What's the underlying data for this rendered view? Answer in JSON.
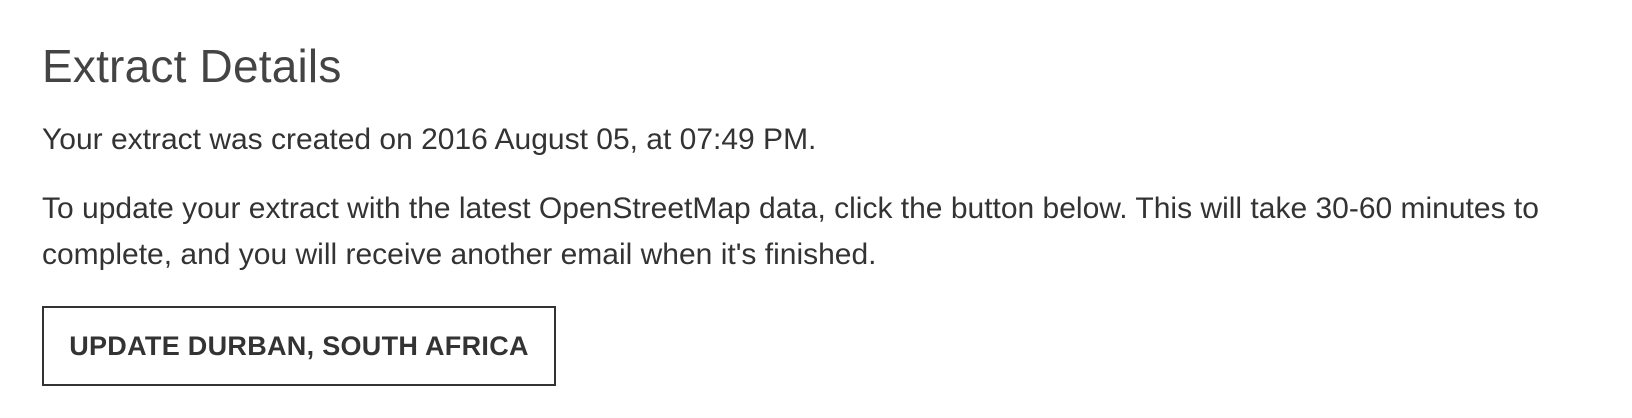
{
  "extract_details": {
    "title": "Extract Details",
    "created_text": "Your extract was created on 2016 August 05, at 07:49 PM.",
    "update_text": "To update your extract with the latest OpenStreetMap data, click the button below. This will take 30-60 minutes to complete, and you will receive another email when it's finished.",
    "button_label": "UPDATE DURBAN, SOUTH AFRICA"
  }
}
